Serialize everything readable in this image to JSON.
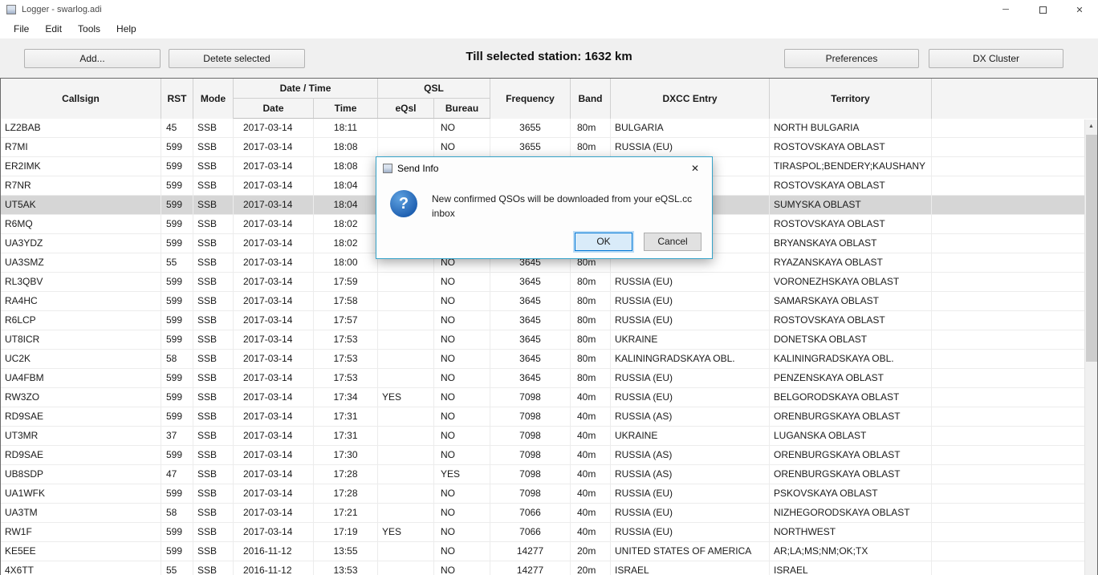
{
  "colors": {
    "accent": "#0078d7",
    "selection": "#d6d6d6",
    "dialog_border": "#35a3c9"
  },
  "icons": {
    "minimize": "─",
    "close": "✕",
    "dialog_close": "✕",
    "question": "?",
    "scroll_up": "▲"
  },
  "window": {
    "title": "Logger - swarlog.adi",
    "menu": [
      "File",
      "Edit",
      "Tools",
      "Help"
    ]
  },
  "toolbar": {
    "add_label": "Add...",
    "delete_label": "Detete selected",
    "distance_label": "Till selected station: 1632 km",
    "preferences_label": "Preferences",
    "dx_cluster_label": "DX Cluster"
  },
  "table": {
    "headers": {
      "callsign": "Callsign",
      "rst": "RST",
      "mode": "Mode",
      "datetime_group": "Date / Time",
      "date": "Date",
      "time": "Time",
      "qsl_group": "QSL",
      "eqsl": "eQsl",
      "bureau": "Bureau",
      "frequency": "Frequency",
      "band": "Band",
      "dxcc": "DXCC Entry",
      "territory": "Territory"
    },
    "rows": [
      {
        "callsign": "LZ2BAB",
        "rst": "45",
        "mode": "SSB",
        "date": "2017-03-14",
        "time": "18:11",
        "eqsl": "",
        "bureau": "NO",
        "frequency": "3655",
        "band": "80m",
        "dxcc": "BULGARIA",
        "territory": "NORTH BULGARIA"
      },
      {
        "callsign": "R7MI",
        "rst": "599",
        "mode": "SSB",
        "date": "2017-03-14",
        "time": "18:08",
        "eqsl": "",
        "bureau": "NO",
        "frequency": "3655",
        "band": "80m",
        "dxcc": "RUSSIA (EU)",
        "territory": "ROSTOVSKAYA OBLAST"
      },
      {
        "callsign": "ER2IMK",
        "rst": "599",
        "mode": "SSB",
        "date": "2017-03-14",
        "time": "18:08",
        "eqsl": "",
        "bureau": "",
        "frequency": "",
        "band": "",
        "dxcc": "",
        "territory": "TIRASPOL;BENDERY;KAUSHANY"
      },
      {
        "callsign": "R7NR",
        "rst": "599",
        "mode": "SSB",
        "date": "2017-03-14",
        "time": "18:04",
        "eqsl": "",
        "bureau": "",
        "frequency": "",
        "band": "",
        "dxcc": "",
        "territory": "ROSTOVSKAYA OBLAST"
      },
      {
        "callsign": "UT5AK",
        "rst": "599",
        "mode": "SSB",
        "date": "2017-03-14",
        "time": "18:04",
        "eqsl": "",
        "bureau": "",
        "frequency": "",
        "band": "",
        "dxcc": "",
        "territory": "SUMYSKA OBLAST",
        "selected": true
      },
      {
        "callsign": "R6MQ",
        "rst": "599",
        "mode": "SSB",
        "date": "2017-03-14",
        "time": "18:02",
        "eqsl": "",
        "bureau": "",
        "frequency": "",
        "band": "",
        "dxcc": "",
        "territory": "ROSTOVSKAYA OBLAST"
      },
      {
        "callsign": "UA3YDZ",
        "rst": "599",
        "mode": "SSB",
        "date": "2017-03-14",
        "time": "18:02",
        "eqsl": "",
        "bureau": "",
        "frequency": "",
        "band": "",
        "dxcc": "",
        "territory": "BRYANSKAYA OBLAST"
      },
      {
        "callsign": "UA3SMZ",
        "rst": "55",
        "mode": "SSB",
        "date": "2017-03-14",
        "time": "18:00",
        "eqsl": "",
        "bureau": "NO",
        "frequency": "3645",
        "band": "80m",
        "dxcc": "",
        "territory": "RYAZANSKAYA OBLAST"
      },
      {
        "callsign": "RL3QBV",
        "rst": "599",
        "mode": "SSB",
        "date": "2017-03-14",
        "time": "17:59",
        "eqsl": "",
        "bureau": "NO",
        "frequency": "3645",
        "band": "80m",
        "dxcc": "RUSSIA (EU)",
        "territory": "VORONEZHSKAYA OBLAST"
      },
      {
        "callsign": "RA4HC",
        "rst": "599",
        "mode": "SSB",
        "date": "2017-03-14",
        "time": "17:58",
        "eqsl": "",
        "bureau": "NO",
        "frequency": "3645",
        "band": "80m",
        "dxcc": "RUSSIA (EU)",
        "territory": "SAMARSKAYA OBLAST"
      },
      {
        "callsign": "R6LCP",
        "rst": "599",
        "mode": "SSB",
        "date": "2017-03-14",
        "time": "17:57",
        "eqsl": "",
        "bureau": "NO",
        "frequency": "3645",
        "band": "80m",
        "dxcc": "RUSSIA (EU)",
        "territory": "ROSTOVSKAYA OBLAST"
      },
      {
        "callsign": "UT8ICR",
        "rst": "599",
        "mode": "SSB",
        "date": "2017-03-14",
        "time": "17:53",
        "eqsl": "",
        "bureau": "NO",
        "frequency": "3645",
        "band": "80m",
        "dxcc": "UKRAINE",
        "territory": "DONETSKA OBLAST"
      },
      {
        "callsign": "UC2K",
        "rst": "58",
        "mode": "SSB",
        "date": "2017-03-14",
        "time": "17:53",
        "eqsl": "",
        "bureau": "NO",
        "frequency": "3645",
        "band": "80m",
        "dxcc": "KALININGRADSKAYA OBL.",
        "territory": "KALININGRADSKAYA OBL."
      },
      {
        "callsign": "UA4FBM",
        "rst": "599",
        "mode": "SSB",
        "date": "2017-03-14",
        "time": "17:53",
        "eqsl": "",
        "bureau": "NO",
        "frequency": "3645",
        "band": "80m",
        "dxcc": "RUSSIA (EU)",
        "territory": "PENZENSKAYA OBLAST"
      },
      {
        "callsign": "RW3ZO",
        "rst": "599",
        "mode": "SSB",
        "date": "2017-03-14",
        "time": "17:34",
        "eqsl": "YES",
        "bureau": "NO",
        "frequency": "7098",
        "band": "40m",
        "dxcc": "RUSSIA (EU)",
        "territory": "BELGORODSKAYA OBLAST"
      },
      {
        "callsign": "RD9SAE",
        "rst": "599",
        "mode": "SSB",
        "date": "2017-03-14",
        "time": "17:31",
        "eqsl": "",
        "bureau": "NO",
        "frequency": "7098",
        "band": "40m",
        "dxcc": "RUSSIA (AS)",
        "territory": "ORENBURGSKAYA OBLAST"
      },
      {
        "callsign": "UT3MR",
        "rst": "37",
        "mode": "SSB",
        "date": "2017-03-14",
        "time": "17:31",
        "eqsl": "",
        "bureau": "NO",
        "frequency": "7098",
        "band": "40m",
        "dxcc": "UKRAINE",
        "territory": "LUGANSKA OBLAST"
      },
      {
        "callsign": "RD9SAE",
        "rst": "599",
        "mode": "SSB",
        "date": "2017-03-14",
        "time": "17:30",
        "eqsl": "",
        "bureau": "NO",
        "frequency": "7098",
        "band": "40m",
        "dxcc": "RUSSIA (AS)",
        "territory": "ORENBURGSKAYA OBLAST"
      },
      {
        "callsign": "UB8SDP",
        "rst": "47",
        "mode": "SSB",
        "date": "2017-03-14",
        "time": "17:28",
        "eqsl": "",
        "bureau": "YES",
        "frequency": "7098",
        "band": "40m",
        "dxcc": "RUSSIA (AS)",
        "territory": "ORENBURGSKAYA OBLAST"
      },
      {
        "callsign": "UA1WFK",
        "rst": "599",
        "mode": "SSB",
        "date": "2017-03-14",
        "time": "17:28",
        "eqsl": "",
        "bureau": "NO",
        "frequency": "7098",
        "band": "40m",
        "dxcc": "RUSSIA (EU)",
        "territory": "PSKOVSKAYA OBLAST"
      },
      {
        "callsign": "UA3TM",
        "rst": "58",
        "mode": "SSB",
        "date": "2017-03-14",
        "time": "17:21",
        "eqsl": "",
        "bureau": "NO",
        "frequency": "7066",
        "band": "40m",
        "dxcc": "RUSSIA (EU)",
        "territory": "NIZHEGORODSKAYA OBLAST"
      },
      {
        "callsign": "RW1F",
        "rst": "599",
        "mode": "SSB",
        "date": "2017-03-14",
        "time": "17:19",
        "eqsl": "YES",
        "bureau": "NO",
        "frequency": "7066",
        "band": "40m",
        "dxcc": "RUSSIA (EU)",
        "territory": "NORTHWEST"
      },
      {
        "callsign": "KE5EE",
        "rst": "599",
        "mode": "SSB",
        "date": "2016-11-12",
        "time": "13:55",
        "eqsl": "",
        "bureau": "NO",
        "frequency": "14277",
        "band": "20m",
        "dxcc": "UNITED STATES OF AMERICA",
        "territory": "AR;LA;MS;NM;OK;TX"
      },
      {
        "callsign": "4X6TT",
        "rst": "55",
        "mode": "SSB",
        "date": "2016-11-12",
        "time": "13:53",
        "eqsl": "",
        "bureau": "NO",
        "frequency": "14277",
        "band": "20m",
        "dxcc": "ISRAEL",
        "territory": "ISRAEL"
      }
    ]
  },
  "dialog": {
    "title": "Send Info",
    "message": "New confirmed QSOs will be downloaded from your eQSL.cc inbox",
    "ok_label": "OK",
    "cancel_label": "Cancel"
  }
}
